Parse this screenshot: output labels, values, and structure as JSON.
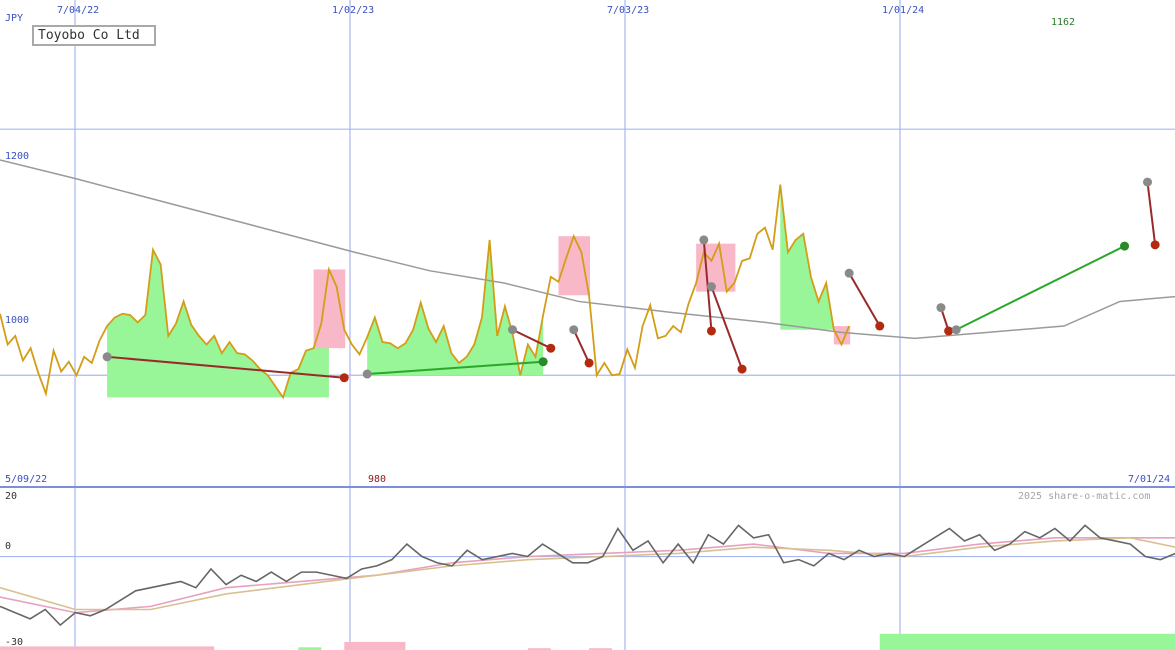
{
  "chart_data": [
    {
      "type": "line",
      "title": "Toyobo Co Ltd",
      "currency": "JPY",
      "x_start": "2022-03-25",
      "date_ticks": [
        "7/04/22",
        "1/02/23",
        "7/03/23",
        "1/01/24"
      ],
      "range_start_label": "5/09/22",
      "range_end_label": "7/01/24",
      "ylim": [
        910,
        1305
      ],
      "y_ticks": [
        1000,
        1200
      ],
      "max_label": "1162",
      "min_label": "980",
      "watermark": "2025 share-o-matic.com",
      "series": [
        {
          "name": "",
          "color": "#d39d17",
          "weekly_closes": [
            1050,
            1025,
            1032,
            1012,
            1022,
            1002,
            985,
            1020,
            1003,
            1011,
            1000,
            1015,
            1010,
            1028,
            1040,
            1047,
            1050,
            1049,
            1043,
            1049,
            1102,
            1090,
            1032,
            1042,
            1060,
            1041,
            1032,
            1025,
            1032,
            1018,
            1027,
            1018,
            1017,
            1012,
            1005,
            1000,
            991,
            982,
            1002,
            1005,
            1020,
            1022,
            1042,
            1086,
            1072,
            1037,
            1025,
            1017,
            1031,
            1047,
            1027,
            1026,
            1022,
            1026,
            1037,
            1059,
            1038,
            1027,
            1040,
            1018,
            1010,
            1015,
            1025,
            1047,
            1110,
            1032,
            1056,
            1034,
            1000,
            1025,
            1015,
            1049,
            1080,
            1076,
            1095,
            1113,
            1100,
            1065,
            1000,
            1010,
            1000,
            1001,
            1021,
            1006,
            1040,
            1057,
            1030,
            1032,
            1040,
            1035,
            1058,
            1075,
            1100,
            1093,
            1107,
            1068,
            1075,
            1093,
            1095,
            1115,
            1120,
            1102,
            1155,
            1100,
            1110,
            1115,
            1080,
            1060,
            1075,
            1037,
            1025,
            1040
          ]
        },
        {
          "name": "",
          "color": "#9a9a9a",
          "sma_points": [
            [
              0,
              1175
            ],
            [
              8,
              1160
            ],
            [
              18,
              1140
            ],
            [
              28,
              1120
            ],
            [
              38,
              1100
            ],
            [
              46,
              1085
            ],
            [
              54,
              1075
            ],
            [
              62,
              1060
            ],
            [
              72,
              1051
            ],
            [
              82,
              1043
            ],
            [
              90,
              1035
            ],
            [
              98,
              1030
            ],
            [
              106,
              1035
            ],
            [
              114,
              1040
            ],
            [
              120,
              1060
            ],
            [
              126,
              1064
            ]
          ]
        }
      ],
      "trades": [
        {
          "entry_week": 14,
          "entry_price": 1015,
          "exit_week": 45,
          "exit_price": 998,
          "result": "loss"
        },
        {
          "entry_week": 48,
          "entry_price": 1001,
          "exit_week": 71,
          "exit_price": 1011,
          "result": "gain"
        },
        {
          "entry_week": 67,
          "entry_price": 1037,
          "exit_week": 72,
          "exit_price": 1022,
          "result": "loss"
        },
        {
          "entry_week": 75,
          "entry_price": 1037,
          "exit_week": 77,
          "exit_price": 1010,
          "result": "loss"
        },
        {
          "entry_week": 92,
          "entry_price": 1110,
          "exit_week": 93,
          "exit_price": 1036,
          "result": "loss"
        },
        {
          "entry_week": 93,
          "entry_price": 1072,
          "exit_week": 97,
          "exit_price": 1005,
          "result": "loss"
        },
        {
          "entry_week": 111,
          "entry_price": 1083,
          "exit_week": 115,
          "exit_price": 1040,
          "result": "loss"
        },
        {
          "entry_week": 123,
          "entry_price": 1055,
          "exit_week": 124,
          "exit_price": 1036,
          "result": "loss"
        },
        {
          "entry_week": 125,
          "entry_price": 1037,
          "exit_week": 147,
          "exit_price": 1105,
          "result": "gain"
        },
        {
          "entry_week": 150,
          "entry_price": 1157,
          "exit_week": 151,
          "exit_price": 1106,
          "result": "loss"
        }
      ],
      "gain_areas": [
        {
          "from_week": 14,
          "to_week": 43
        },
        {
          "from_week": 48,
          "to_week": 71
        },
        {
          "from_week": 92,
          "to_week": 96
        },
        {
          "from_week": 102,
          "to_week": 109
        },
        {
          "from_week": 125,
          "to_week": 147
        }
      ],
      "loss_areas": [
        {
          "from_week": 41,
          "to_week": 45
        },
        {
          "from_week": 73,
          "to_week": 77
        },
        {
          "from_week": 91,
          "to_week": 96
        },
        {
          "from_week": 109,
          "to_week": 111
        },
        {
          "from_week": 123,
          "to_week": 124
        },
        {
          "from_week": 149,
          "to_week": 151
        }
      ]
    },
    {
      "type": "line",
      "ylim": [
        -30,
        22
      ],
      "y_ticks": [
        20,
        0,
        -30
      ],
      "series": [
        {
          "name": "",
          "color": "#666666",
          "points": [
            [
              0,
              -16
            ],
            [
              2,
              -18
            ],
            [
              4,
              -20
            ],
            [
              6,
              -17
            ],
            [
              8,
              -22
            ],
            [
              10,
              -18
            ],
            [
              12,
              -19
            ],
            [
              14,
              -17
            ],
            [
              16,
              -14
            ],
            [
              18,
              -11
            ],
            [
              20,
              -10
            ],
            [
              22,
              -9
            ],
            [
              24,
              -8
            ],
            [
              26,
              -10
            ],
            [
              28,
              -4
            ],
            [
              30,
              -9
            ],
            [
              32,
              -6
            ],
            [
              34,
              -8
            ],
            [
              36,
              -5
            ],
            [
              38,
              -8
            ],
            [
              40,
              -5
            ],
            [
              42,
              -5
            ],
            [
              44,
              -6
            ],
            [
              46,
              -7
            ],
            [
              48,
              -4
            ],
            [
              50,
              -3
            ],
            [
              52,
              -1
            ],
            [
              54,
              4
            ],
            [
              56,
              0
            ],
            [
              58,
              -2
            ],
            [
              60,
              -3
            ],
            [
              62,
              2
            ],
            [
              64,
              -1
            ],
            [
              66,
              0
            ],
            [
              68,
              1
            ],
            [
              70,
              0
            ],
            [
              72,
              4
            ],
            [
              74,
              1
            ],
            [
              76,
              -2
            ],
            [
              78,
              -2
            ],
            [
              80,
              0
            ],
            [
              82,
              9
            ],
            [
              84,
              2
            ],
            [
              86,
              5
            ],
            [
              88,
              -2
            ],
            [
              90,
              4
            ],
            [
              92,
              -2
            ],
            [
              94,
              7
            ],
            [
              96,
              4
            ],
            [
              98,
              10
            ],
            [
              100,
              6
            ],
            [
              102,
              7
            ],
            [
              104,
              -2
            ],
            [
              106,
              -1
            ],
            [
              108,
              -3
            ],
            [
              110,
              1
            ],
            [
              112,
              -1
            ],
            [
              114,
              2
            ],
            [
              116,
              0
            ],
            [
              118,
              1
            ],
            [
              120,
              0
            ],
            [
              122,
              3
            ],
            [
              124,
              6
            ],
            [
              126,
              9
            ],
            [
              128,
              5
            ],
            [
              130,
              7
            ],
            [
              132,
              2
            ],
            [
              134,
              4
            ],
            [
              136,
              8
            ],
            [
              138,
              6
            ],
            [
              140,
              9
            ],
            [
              142,
              5
            ],
            [
              144,
              10
            ],
            [
              146,
              6
            ],
            [
              148,
              5
            ],
            [
              150,
              4
            ],
            [
              152,
              0
            ],
            [
              154,
              -1
            ],
            [
              156,
              1
            ]
          ]
        },
        {
          "name": "",
          "color": "#e8a0c0",
          "points": [
            [
              0,
              -13
            ],
            [
              10,
              -18
            ],
            [
              20,
              -16
            ],
            [
              30,
              -10
            ],
            [
              40,
              -8
            ],
            [
              50,
              -6
            ],
            [
              60,
              -2
            ],
            [
              70,
              0
            ],
            [
              80,
              1
            ],
            [
              90,
              2
            ],
            [
              100,
              4
            ],
            [
              110,
              1
            ],
            [
              120,
              1
            ],
            [
              130,
              4
            ],
            [
              140,
              6
            ],
            [
              150,
              6
            ],
            [
              156,
              6
            ]
          ]
        },
        {
          "name": "",
          "color": "#d8c090",
          "points": [
            [
              0,
              -10
            ],
            [
              10,
              -17
            ],
            [
              20,
              -17
            ],
            [
              30,
              -12
            ],
            [
              40,
              -9
            ],
            [
              50,
              -6
            ],
            [
              60,
              -3
            ],
            [
              70,
              -1
            ],
            [
              80,
              0
            ],
            [
              90,
              1
            ],
            [
              100,
              3
            ],
            [
              110,
              2
            ],
            [
              120,
              0
            ],
            [
              130,
              3
            ],
            [
              140,
              5
            ],
            [
              150,
              6
            ],
            [
              156,
              3
            ]
          ]
        }
      ],
      "volume_bars": [
        {
          "from_week": 0,
          "to_week": 28,
          "magnitude": 4,
          "sign": "negative"
        },
        {
          "from_week": 39,
          "to_week": 42,
          "magnitude": 3,
          "sign": "positive"
        },
        {
          "from_week": 45,
          "to_week": 53,
          "magnitude": 9,
          "sign": "negative"
        },
        {
          "from_week": 69,
          "to_week": 72,
          "magnitude": 2,
          "sign": "negative"
        },
        {
          "from_week": 77,
          "to_week": 80,
          "magnitude": 2,
          "sign": "negative"
        },
        {
          "from_week": 115,
          "to_week": 156,
          "magnitude": 18,
          "sign": "positive"
        }
      ]
    }
  ],
  "colors": {
    "grid": "#a8b8f0",
    "axis_text": "#3a50c0",
    "max_text": "#2a7a2a",
    "min_text": "#8b1a1a",
    "gain_fill": "#98f598",
    "loss_fill": "#f8b8c8",
    "gain_line": "#2aa82a",
    "loss_line": "#9a2a2a",
    "marker_entry": "#8a8a8a",
    "marker_exit_gain": "#2a8a2a",
    "marker_exit_loss": "#b22a10",
    "watermark": "#a6a6a6"
  }
}
